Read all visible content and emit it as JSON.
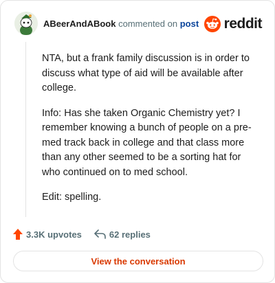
{
  "header": {
    "author": "ABeerAndABook",
    "verb": "commented on",
    "post_link": "post",
    "brand": "reddit"
  },
  "comment": {
    "paragraphs": [
      "NTA, but a frank family discussion is in order to discuss what type of aid will be available after college.",
      "Info: Has she taken Organic Chemistry yet? I remember knowing a bunch of people on a pre-med track back in college and that class more than any other seemed to be a sorting hat for who continued on to med school.",
      "Edit: spelling."
    ]
  },
  "stats": {
    "upvotes": "3.3K upvotes",
    "replies": "62 replies"
  },
  "cta": {
    "label": "View the conversation"
  },
  "colors": {
    "brand_orange": "#ff4500",
    "link_blue": "#0a449b",
    "cta_text": "#d93900",
    "upvote_icon": "#ff4500"
  },
  "icons": {
    "avatar": "snoo-avatar-icon",
    "brand": "reddit-logo-icon",
    "upvote": "upvote-arrow-icon",
    "reply": "reply-arrow-icon"
  }
}
